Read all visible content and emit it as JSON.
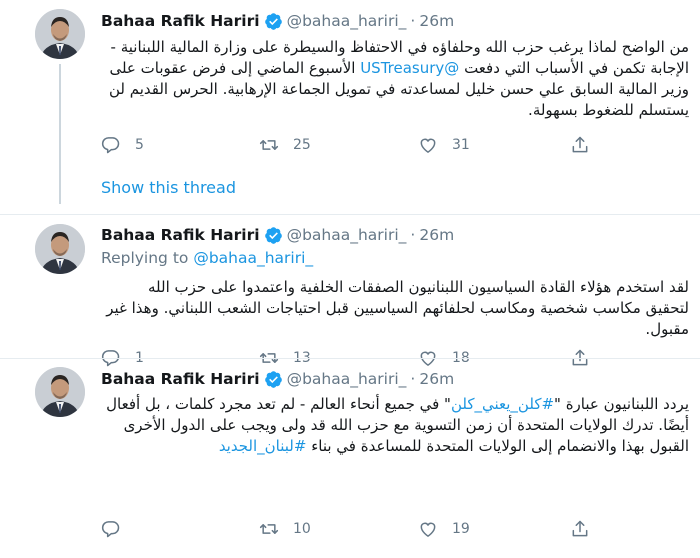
{
  "colors": {
    "accent": "#1b95e0",
    "muted": "#657786",
    "text": "#14171a",
    "divider": "#e6ecf0"
  },
  "icons": [
    "reply-icon",
    "retweet-icon",
    "like-icon",
    "share-icon",
    "verified-icon"
  ],
  "tweets": [
    {
      "author": "Bahaa Rafik Hariri",
      "handle": "@bahaa_hariri_",
      "dot": "·",
      "time": "26m",
      "text_part1": "من الواضح لماذا يرغب حزب الله وحلفاؤه في الاحتفاظ والسيطرة على وزارة المالية اللبنانية - الإجابة تكمن في الأسباب التي دفعت ",
      "mention": "@USTreasury",
      "text_part2": " الأسبوع الماضي إلى فرض عقوبات على وزير المالية السابق علي حسن خليل لمساعدته في تمويل الجماعة الإرهابية.  الحرس القديم لن يستسلم للضغوط بسهولة.",
      "replies": "5",
      "retweets": "25",
      "likes": "31",
      "show_thread": "Show this thread"
    },
    {
      "author": "Bahaa Rafik Hariri",
      "handle": "@bahaa_hariri_",
      "dot": "·",
      "time": "26m",
      "replying_label": "Replying to",
      "replying_handle": "@bahaa_hariri_",
      "text": "لقد استخدم هؤلاء القادة السياسيون اللبنانيون الصفقات الخلفية واعتمدوا على حزب الله لتحقيق مكاسب شخصية ومكاسب لحلفائهم السياسيين قبل احتياجات الشعب اللبناني. وهذا غير مقبول.",
      "replies": "1",
      "retweets": "13",
      "likes": "18"
    },
    {
      "author": "Bahaa Rafik Hariri",
      "handle": "@bahaa_hariri_",
      "dot": "·",
      "time": "26m",
      "text_part1": "يردد اللبنانيون عبارة \"",
      "hashtag1": "#كلن_يعني_كلن",
      "text_part2": "\" في جميع أنحاء العالم - لم تعد مجرد كلمات ، بل أفعال أيضًا. تدرك الولايات المتحدة أن زمن التسوية مع حزب الله قد ولى ويجب على الدول الأخرى القبول بهذا والانضمام إلى الولايات المتحدة للمساعدة في بناء ",
      "hashtag2": "#لبنان_الجديد",
      "retweets": "10",
      "likes": "19"
    }
  ]
}
